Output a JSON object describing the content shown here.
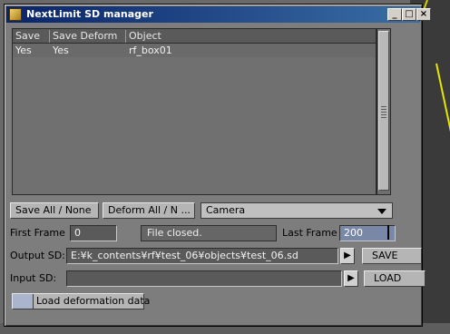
{
  "window": {
    "title": "NextLimit SD manager",
    "minimize": "_",
    "maximize": "□",
    "close": "×"
  },
  "table": {
    "columns": [
      "Save",
      "Save Deform",
      "Object"
    ],
    "rows": [
      [
        "Yes",
        "Yes",
        "rf_box01"
      ]
    ]
  },
  "toolbar": {
    "save_all": "Save All / None",
    "deform_all": "Deform All / N ...",
    "camera_select": "Camera"
  },
  "frames": {
    "first_label": "First Frame",
    "first_value": "0",
    "status": "File closed.",
    "last_label": "Last Frame",
    "last_value": "200"
  },
  "output": {
    "label": "Output SD:",
    "path": "E:¥k_contents¥rf¥test_06¥objects¥test_06.sd",
    "button": "SAVE"
  },
  "input": {
    "label": "Input SD:",
    "path": "",
    "button": "LOAD"
  },
  "deformation": {
    "label": "Load deformation data"
  }
}
